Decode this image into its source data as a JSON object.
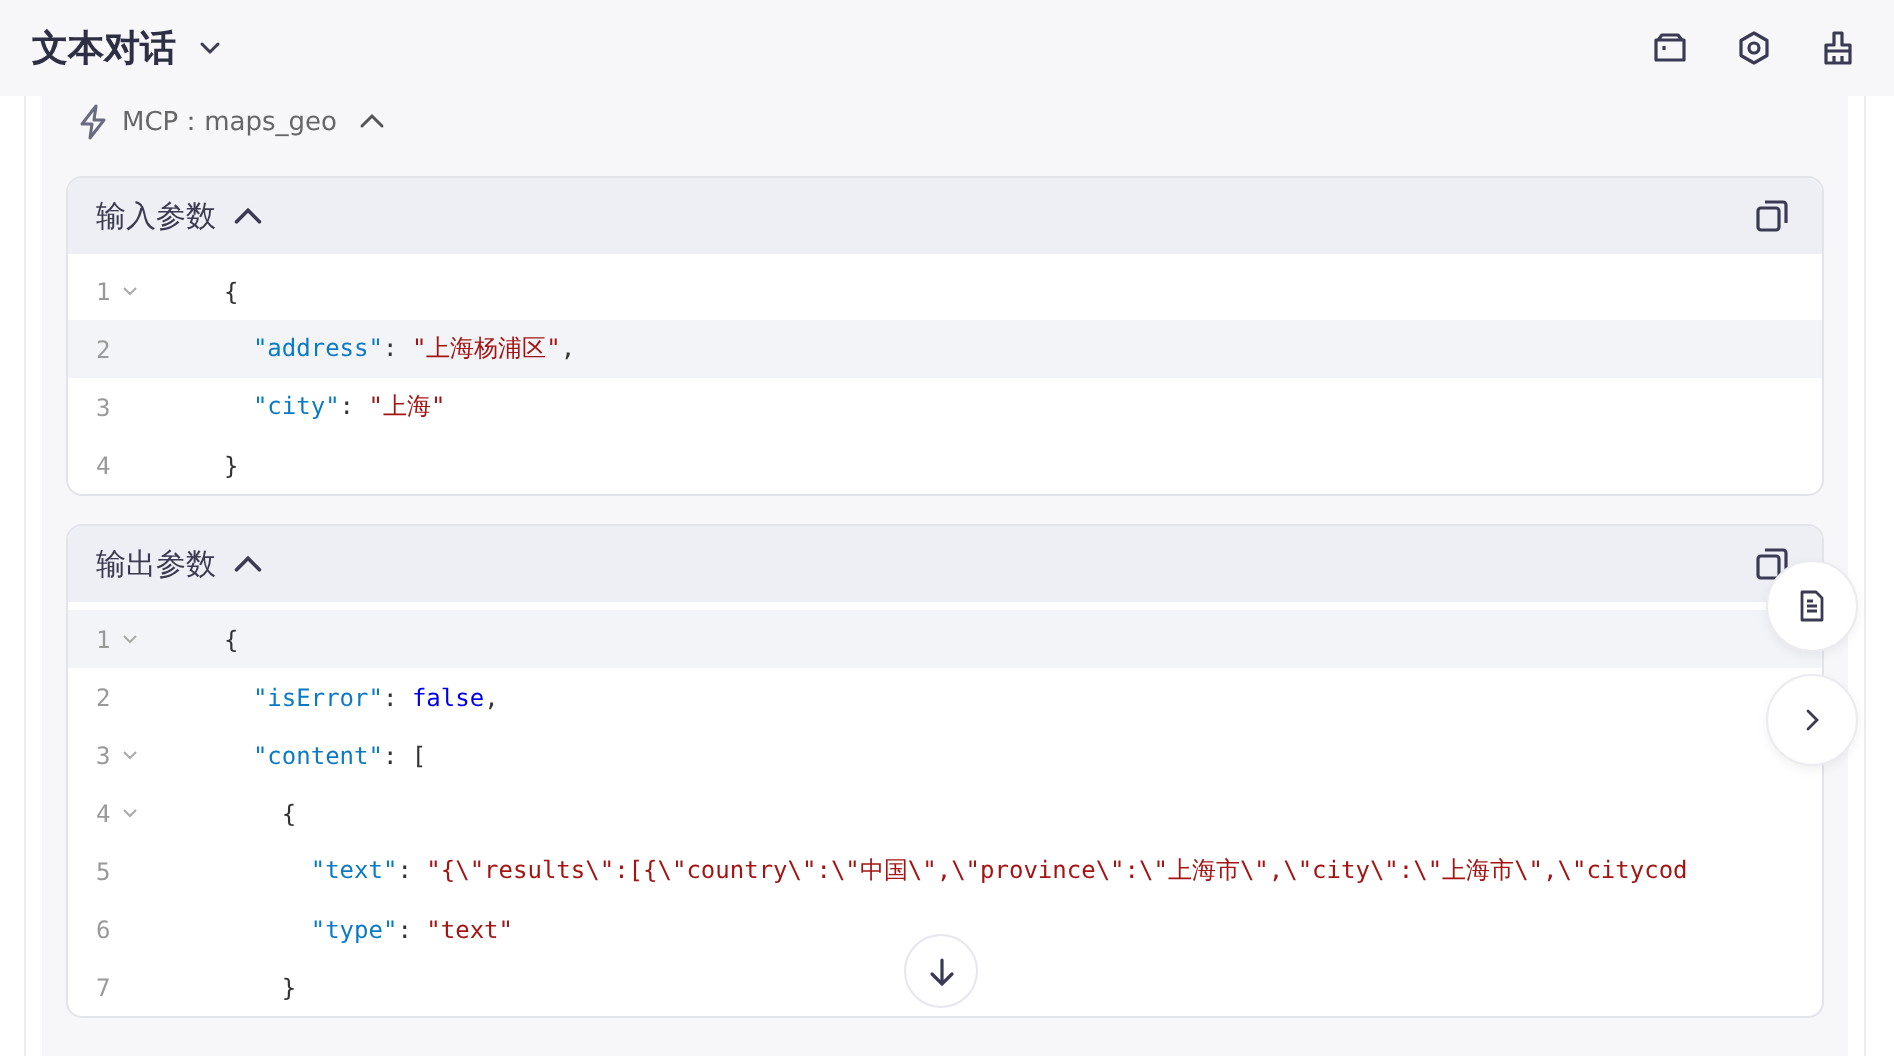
{
  "header": {
    "title": "文本对话"
  },
  "tool": {
    "label": "MCP：maps_geo",
    "expanded": true
  },
  "sections": [
    {
      "title": "输入参数",
      "expanded": true,
      "lines": [
        {
          "number": "1",
          "foldable": true,
          "active": false,
          "tokens": [
            {
              "kind": "punct",
              "text": "{"
            }
          ]
        },
        {
          "number": "2",
          "foldable": false,
          "active": true,
          "tokens": [
            {
              "kind": "key",
              "text": "  \"address\""
            },
            {
              "kind": "punct",
              "text": ": "
            },
            {
              "kind": "string",
              "text": "\"上海杨浦区\""
            },
            {
              "kind": "punct",
              "text": ","
            }
          ]
        },
        {
          "number": "3",
          "foldable": false,
          "active": false,
          "tokens": [
            {
              "kind": "key",
              "text": "  \"city\""
            },
            {
              "kind": "punct",
              "text": ": "
            },
            {
              "kind": "string",
              "text": "\"上海\""
            }
          ]
        },
        {
          "number": "4",
          "foldable": false,
          "active": false,
          "tokens": [
            {
              "kind": "punct",
              "text": "}"
            }
          ]
        }
      ]
    },
    {
      "title": "输出参数",
      "expanded": true,
      "lines": [
        {
          "number": "1",
          "foldable": true,
          "active": true,
          "tokens": [
            {
              "kind": "punct",
              "text": "{"
            }
          ]
        },
        {
          "number": "2",
          "foldable": false,
          "active": false,
          "tokens": [
            {
              "kind": "key",
              "text": "  \"isError\""
            },
            {
              "kind": "punct",
              "text": ": "
            },
            {
              "kind": "keyword",
              "text": "false"
            },
            {
              "kind": "punct",
              "text": ","
            }
          ]
        },
        {
          "number": "3",
          "foldable": true,
          "active": false,
          "tokens": [
            {
              "kind": "key",
              "text": "  \"content\""
            },
            {
              "kind": "punct",
              "text": ": ["
            }
          ]
        },
        {
          "number": "4",
          "foldable": true,
          "active": false,
          "tokens": [
            {
              "kind": "punct",
              "text": "    {"
            }
          ]
        },
        {
          "number": "5",
          "foldable": false,
          "active": false,
          "tokens": [
            {
              "kind": "key",
              "text": "      \"text\""
            },
            {
              "kind": "punct",
              "text": ": "
            },
            {
              "kind": "string",
              "text": "\"{\\\"results\\\":[{\\\"country\\\":\\\"中国\\\",\\\"province\\\":\\\"上海市\\\",\\\"city\\\":\\\"上海市\\\",\\\"citycod"
            }
          ]
        },
        {
          "number": "6",
          "foldable": false,
          "active": false,
          "tokens": [
            {
              "kind": "key",
              "text": "      \"type\""
            },
            {
              "kind": "punct",
              "text": ": "
            },
            {
              "kind": "string",
              "text": "\"text\""
            }
          ]
        },
        {
          "number": "7",
          "foldable": false,
          "active": false,
          "tokens": [
            {
              "kind": "punct",
              "text": "    }"
            }
          ]
        }
      ]
    }
  ]
}
